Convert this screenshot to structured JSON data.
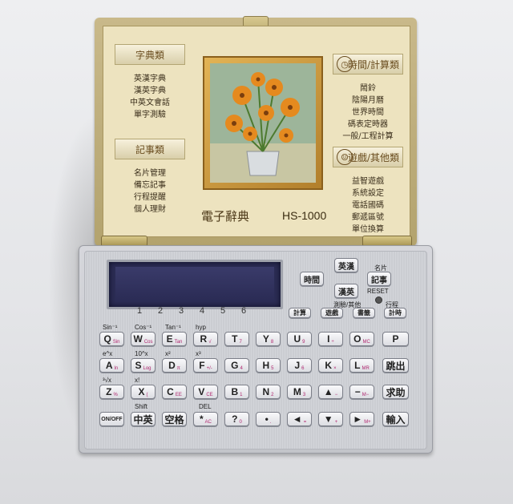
{
  "lid": {
    "left_heading": "字典類",
    "left_items": [
      "英漢字典",
      "漢英字典",
      "中英文會話",
      "單字測驗"
    ],
    "left2_heading": "記事類",
    "left2_items": [
      "名片管理",
      "備忘記事",
      "行程提醒",
      "個人理財"
    ],
    "right_heading": "時間/計算類",
    "right_items": [
      "鬧鈴",
      "陰陽月曆",
      "世界時間",
      "碼表定時器",
      "一般/工程計算"
    ],
    "right2_heading": "遊戲/其他類",
    "right2_items": [
      "益智遊戲",
      "系統設定",
      "電話國碼",
      "郵遞區號",
      "單位換算"
    ],
    "brand": "電子辭典",
    "model": "HS-1000"
  },
  "lcd_numbers": [
    "1",
    "2",
    "3",
    "4",
    "5",
    "6"
  ],
  "func_keys": {
    "time": "時間",
    "en_ch": "英漢",
    "ch_en": "漢英",
    "memo": "記事",
    "namecard": "名片",
    "reset": "RESET",
    "calc": "計算",
    "game": "遊戲",
    "test_other": "測驗/其他",
    "book": "書籤",
    "schedule": "行程",
    "clock": "計時"
  },
  "keys": {
    "row1": [
      {
        "main": "Q",
        "sub": "Sin"
      },
      {
        "main": "W",
        "sub": "Cos"
      },
      {
        "main": "E",
        "sub": "Tan"
      },
      {
        "main": "R",
        "sub": "√"
      },
      {
        "main": "T",
        "sub": "7"
      },
      {
        "main": "Y",
        "sub": "8"
      },
      {
        "main": "U",
        "sub": "9"
      },
      {
        "main": "I",
        "sub": "÷"
      },
      {
        "main": "O",
        "sub": "MC"
      },
      {
        "main": "P",
        "sub": ""
      }
    ],
    "row2": [
      {
        "main": "A",
        "sub": "ln"
      },
      {
        "main": "S",
        "sub": "Log"
      },
      {
        "main": "D",
        "sub": "π"
      },
      {
        "main": "F",
        "sub": "+/-"
      },
      {
        "main": "G",
        "sub": "4"
      },
      {
        "main": "H",
        "sub": "5"
      },
      {
        "main": "J",
        "sub": "6"
      },
      {
        "main": "K",
        "sub": "×"
      },
      {
        "main": "L",
        "sub": "MR"
      },
      {
        "main": "跳出",
        "sub": ""
      }
    ],
    "row3": [
      {
        "main": "Z",
        "sub": "%"
      },
      {
        "main": "X",
        "sub": "("
      },
      {
        "main": "C",
        "sub": "EE"
      },
      {
        "main": "V",
        "sub": "CE"
      },
      {
        "main": "B",
        "sub": "1"
      },
      {
        "main": "N",
        "sub": "2"
      },
      {
        "main": "M",
        "sub": "3"
      },
      {
        "main": "▲",
        "sub": "−"
      },
      {
        "main": "−",
        "sub": "M−"
      },
      {
        "main": "求助",
        "sub": ""
      }
    ],
    "row4": [
      {
        "main": "ON/OFF",
        "sub": ""
      },
      {
        "main": "中英",
        "sub": ""
      },
      {
        "main": "空格",
        "sub": ""
      },
      {
        "main": "*",
        "sub": "AC"
      },
      {
        "main": "?",
        "sub": "0"
      },
      {
        "main": "•",
        "sub": "."
      },
      {
        "main": "◄",
        "sub": "="
      },
      {
        "main": "▼",
        "sub": "+"
      },
      {
        "main": "►",
        "sub": "M+"
      },
      {
        "main": "輸入",
        "sub": ""
      }
    ]
  },
  "above_labels": {
    "row1": [
      "Sin⁻¹",
      "Cos⁻¹",
      "Tan⁻¹",
      "hyp"
    ],
    "row2": [
      "e^x",
      "10^x",
      "x²",
      "x³"
    ],
    "row3": [
      "³√x",
      "x!",
      "",
      ""
    ],
    "row4": [
      "Shift",
      "",
      "DEL",
      ""
    ]
  },
  "colors": {
    "lid": "#c2b27d",
    "base": "#cfd1d6",
    "lcd": "#2c2d55",
    "key": "#eceef1",
    "sub_text": "#b0256e"
  }
}
